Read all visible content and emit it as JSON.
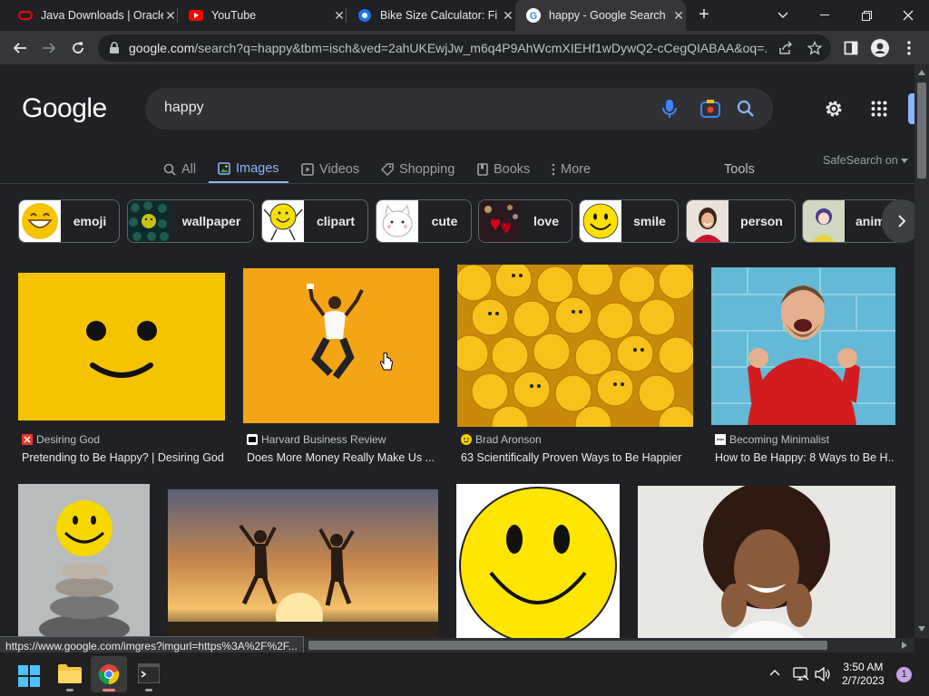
{
  "tabs": [
    {
      "title": "Java Downloads | Oracle",
      "icon": "oracle-icon"
    },
    {
      "title": "YouTube",
      "icon": "youtube-icon"
    },
    {
      "title": "Bike Size Calculator: Fi",
      "icon": "bike-calculator-icon"
    },
    {
      "title": "happy - Google Search",
      "icon": "google-icon",
      "active": true
    }
  ],
  "address_bar": {
    "domain": "google.com",
    "path": "/search?q=happy&tbm=isch&ved=2ahUKEwjJw_m6q4P9AhWcmXIEHf1wDywQ2-cCegQIABAA&oq=..."
  },
  "google": {
    "logo": "Google",
    "query": "happy",
    "tabs": [
      {
        "label": "All"
      },
      {
        "label": "Images",
        "active": true
      },
      {
        "label": "Videos"
      },
      {
        "label": "Shopping"
      },
      {
        "label": "Books"
      },
      {
        "label": "More"
      }
    ],
    "tools": "Tools",
    "safesearch": "SafeSearch on"
  },
  "chips": [
    {
      "label": "emoji",
      "thumb": "emoji-thumbnail"
    },
    {
      "label": "wallpaper",
      "thumb": "wallpaper-thumbnail"
    },
    {
      "label": "clipart",
      "thumb": "clipart-thumbnail"
    },
    {
      "label": "cute",
      "thumb": "cute-thumbnail"
    },
    {
      "label": "love",
      "thumb": "love-thumbnail"
    },
    {
      "label": "smile",
      "thumb": "smile-thumbnail"
    },
    {
      "label": "person",
      "thumb": "person-thumbnail"
    },
    {
      "label": "anim",
      "thumb": "anime-thumbnail"
    }
  ],
  "results": [
    {
      "source": "Desiring God",
      "title": "Pretending to Be Happy? | Desiring God"
    },
    {
      "source": "Harvard Business Review",
      "title": "Does More Money Really Make Us ..."
    },
    {
      "source": "Brad Aronson",
      "title": "63 Scientifically Proven Ways to Be Happier"
    },
    {
      "source": "Becoming Minimalist",
      "title": "How to Be Happy: 8 Ways to Be H..."
    }
  ],
  "status_url": "https://www.google.com/imgres?imgurl=https%3A%2F%2F...",
  "taskbar": {
    "time": "3:50 AM",
    "date": "2/7/2023",
    "notifications": "1"
  },
  "colors": {
    "accent": "#8ab4f8",
    "page_bg": "#202124",
    "toolbar_bg": "#35363a"
  }
}
